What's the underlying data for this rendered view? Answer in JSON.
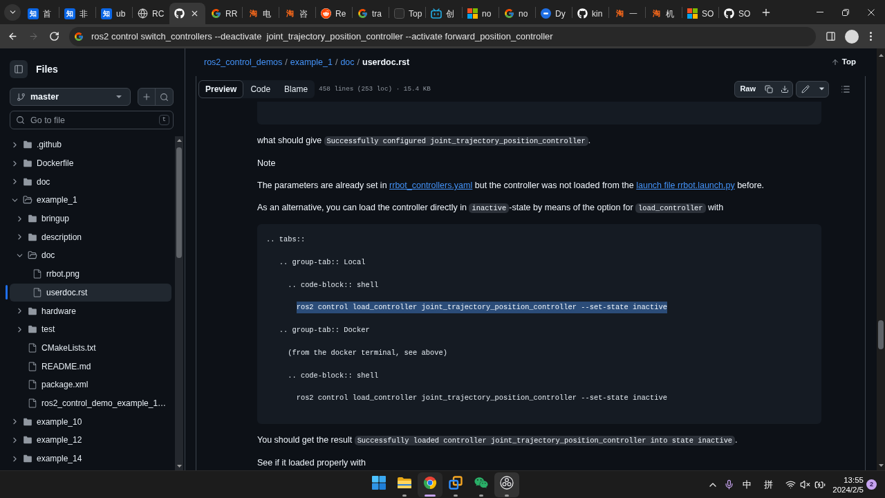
{
  "browser": {
    "tabs": [
      {
        "favicon": {
          "kind": "tile",
          "glyph": "知"
        },
        "title": "首",
        "selected": false
      },
      {
        "favicon": {
          "kind": "tile",
          "glyph": "知"
        },
        "title": "非",
        "selected": false
      },
      {
        "favicon": {
          "kind": "tile",
          "glyph": "知"
        },
        "title": "ub",
        "selected": false
      },
      {
        "favicon": {
          "kind": "globe"
        },
        "title": "RC",
        "selected": false
      },
      {
        "favicon": {
          "kind": "github"
        },
        "selected": true
      },
      {
        "favicon": {
          "kind": "google"
        },
        "title": "RR",
        "selected": false
      },
      {
        "favicon": {
          "kind": "glyph",
          "glyph": "淘"
        },
        "title": "电",
        "selected": false
      },
      {
        "favicon": {
          "kind": "glyph",
          "glyph": "淘"
        },
        "title": "咨",
        "selected": false
      },
      {
        "favicon": {
          "kind": "reddit"
        },
        "title": "Re",
        "selected": false
      },
      {
        "favicon": {
          "kind": "google"
        },
        "title": "tra",
        "selected": false
      },
      {
        "favicon": {
          "kind": "square"
        },
        "title": "Top",
        "selected": false
      },
      {
        "favicon": {
          "kind": "tv"
        },
        "title": "创",
        "selected": false
      },
      {
        "favicon": {
          "kind": "windows"
        },
        "title": "no",
        "selected": false
      },
      {
        "favicon": {
          "kind": "google"
        },
        "title": "no",
        "selected": false
      },
      {
        "favicon": {
          "kind": "dot"
        },
        "title": "Dy",
        "selected": false
      },
      {
        "favicon": {
          "kind": "github"
        },
        "title": "kin",
        "selected": false
      },
      {
        "favicon": {
          "kind": "glyph",
          "glyph": "淘"
        },
        "title": "一",
        "selected": false
      },
      {
        "favicon": {
          "kind": "glyph",
          "glyph": "淘"
        },
        "title": "机",
        "selected": false
      },
      {
        "favicon": {
          "kind": "windows"
        },
        "title": "SO",
        "selected": false
      },
      {
        "favicon": {
          "kind": "github"
        },
        "title": "SO",
        "selected": false
      }
    ],
    "nav": [
      {
        "kind": "back",
        "disabled": false
      },
      {
        "kind": "forward",
        "disabled": true
      },
      {
        "kind": "reload",
        "disabled": false
      }
    ],
    "address_bar": {
      "value": "ros2 control switch_controllers --deactivate  joint_trajectory_position_controller --activate forward_position_controller"
    }
  },
  "sidebar": {
    "title": "Files",
    "branch": "master",
    "search": {
      "placeholder": "Go to file",
      "shortcut": "t"
    },
    "tree": [
      {
        "kind": "folder",
        "name": ".github",
        "expanded": false,
        "selected": false
      },
      {
        "kind": "folder",
        "name": "Dockerfile",
        "expanded": false,
        "selected": false
      },
      {
        "kind": "folder",
        "name": "doc",
        "expanded": false,
        "selected": false
      },
      {
        "kind": "folder",
        "name": "example_1",
        "expanded": true,
        "selected": false,
        "children": [
          {
            "kind": "folder",
            "name": "bringup",
            "expanded": false,
            "selected": false
          },
          {
            "kind": "folder",
            "name": "description",
            "expanded": false,
            "selected": false
          },
          {
            "kind": "folder",
            "name": "doc",
            "expanded": true,
            "selected": false,
            "children": [
              {
                "kind": "file",
                "name": "rrbot.png",
                "selected": false
              },
              {
                "kind": "file",
                "name": "userdoc.rst",
                "selected": true
              }
            ]
          },
          {
            "kind": "folder",
            "name": "hardware",
            "expanded": false,
            "selected": false
          },
          {
            "kind": "folder",
            "name": "test",
            "expanded": false,
            "selected": false
          },
          {
            "kind": "file",
            "name": "CMakeLists.txt",
            "selected": false
          },
          {
            "kind": "file",
            "name": "README.md",
            "selected": false
          },
          {
            "kind": "file",
            "name": "package.xml",
            "selected": false
          },
          {
            "kind": "file",
            "name": "ros2_control_demo_example_1…",
            "selected": false
          }
        ]
      },
      {
        "kind": "folder",
        "name": "example_10",
        "expanded": false,
        "selected": false
      },
      {
        "kind": "folder",
        "name": "example_12",
        "expanded": false,
        "selected": false
      },
      {
        "kind": "folder",
        "name": "example_14",
        "expanded": false,
        "selected": false
      }
    ]
  },
  "file_header": {
    "breadcrumb": [
      {
        "kind": "link",
        "text": "ros2_control_demos"
      },
      {
        "kind": "separator",
        "text": "/"
      },
      {
        "kind": "link",
        "text": "example_1"
      },
      {
        "kind": "separator",
        "text": "/"
      },
      {
        "kind": "link",
        "text": "doc"
      },
      {
        "kind": "separator",
        "text": "/"
      },
      {
        "kind": "current",
        "text": "userdoc.rst"
      }
    ],
    "top_link": "Top",
    "views": [
      {
        "label": "Preview",
        "selected": true
      },
      {
        "label": "Code",
        "selected": false
      },
      {
        "label": "Blame",
        "selected": false
      }
    ],
    "file_info": "458 lines (253 loc) · 15.4 KB",
    "raw_button": "Raw"
  },
  "content": {
    "blocks": [
      {
        "kind": "code"
      },
      {
        "kind": "paragraph",
        "segments": [
          {
            "kind": "text",
            "text": "what should give "
          },
          {
            "kind": "code",
            "text": "Successfully configured joint_trajectory_position_controller"
          },
          {
            "kind": "text",
            "text": "."
          }
        ]
      },
      {
        "kind": "paragraph",
        "segments": [
          {
            "kind": "text",
            "text": "Note"
          }
        ]
      },
      {
        "kind": "paragraph",
        "segments": [
          {
            "kind": "text",
            "text": "The parameters are already set in "
          },
          {
            "kind": "link",
            "text": "rrbot_controllers.yaml"
          },
          {
            "kind": "text",
            "text": " but the controller was not loaded from the "
          },
          {
            "kind": "link",
            "text": "launch file rrbot.launch.py"
          },
          {
            "kind": "text",
            "text": " before."
          }
        ]
      },
      {
        "kind": "paragraph",
        "segments": [
          {
            "kind": "text",
            "text": "As an alternative, you can load the controller directly in "
          },
          {
            "kind": "code",
            "text": "inactive"
          },
          {
            "kind": "text",
            "text": "-state by means of the option for "
          },
          {
            "kind": "code",
            "text": "load_controller"
          },
          {
            "kind": "text",
            "text": " with"
          }
        ]
      },
      {
        "kind": "code",
        "lines": [
          {
            "text": ".. tabs::",
            "highlighted": false
          },
          {
            "text": "   .. group-tab:: Local",
            "highlighted": false
          },
          {
            "text": "     .. code-block:: shell",
            "highlighted": false
          },
          {
            "text": "       ros2 control load_controller joint_trajectory_position_controller --set-state inactive",
            "highlighted": true
          },
          {
            "text": "   .. group-tab:: Docker",
            "highlighted": false
          },
          {
            "text": "     (from the docker terminal, see above)",
            "highlighted": false
          },
          {
            "text": "     .. code-block:: shell",
            "highlighted": false
          },
          {
            "text": "       ros2 control load_controller joint_trajectory_position_controller --set-state inactive",
            "highlighted": false
          }
        ]
      },
      {
        "kind": "paragraph",
        "segments": [
          {
            "kind": "text",
            "text": "You should get the result "
          },
          {
            "kind": "code",
            "text": "Successfully loaded controller joint_trajectory_position_controller into state inactive"
          },
          {
            "kind": "text",
            "text": "."
          }
        ]
      },
      {
        "kind": "paragraph",
        "segments": [
          {
            "kind": "text",
            "text": "See if it loaded properly with"
          }
        ]
      }
    ]
  },
  "taskbar": {
    "apps": [
      {
        "kind": "start",
        "running": false,
        "active": false,
        "hovered": false
      },
      {
        "kind": "explorer",
        "running": true,
        "active": false,
        "hovered": false
      },
      {
        "kind": "chrome",
        "running": true,
        "active": true,
        "hovered": false
      },
      {
        "kind": "tiles",
        "running": true,
        "active": false,
        "hovered": false
      },
      {
        "kind": "wechat",
        "running": true,
        "active": false,
        "hovered": false
      },
      {
        "kind": "obs",
        "running": true,
        "active": false,
        "hovered": true
      }
    ],
    "tray": {
      "mic_in_use": true,
      "input_mode": "中",
      "input_method": "拼",
      "time": "13:55",
      "date": "2024/2/5",
      "notification_count": "2"
    }
  }
}
